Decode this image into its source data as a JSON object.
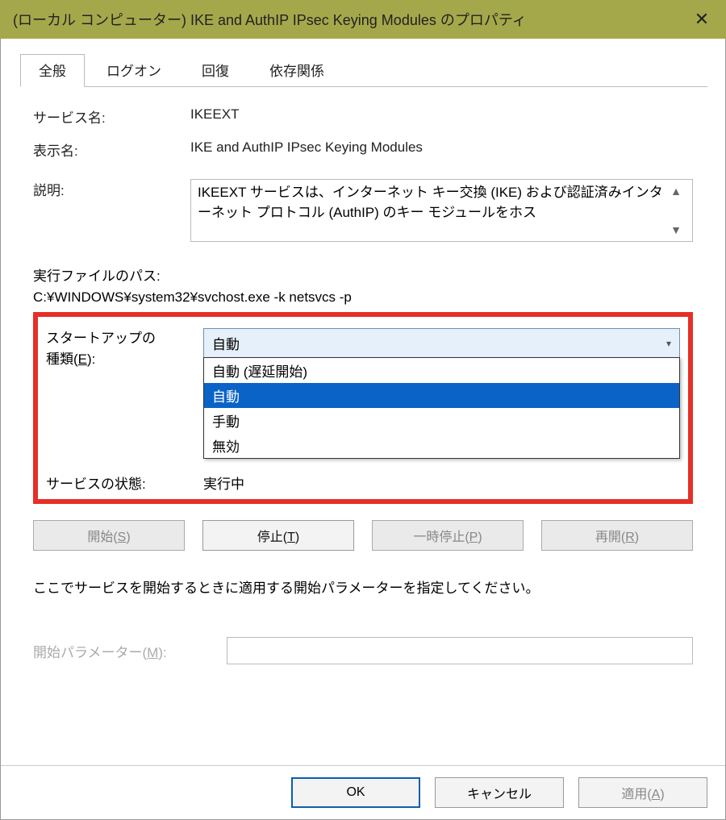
{
  "window": {
    "title": "(ローカル コンピューター) IKE and AuthIP IPsec Keying Modules のプロパティ"
  },
  "tabs": {
    "general": "全般",
    "logon": "ログオン",
    "recovery": "回復",
    "dependencies": "依存関係"
  },
  "fields": {
    "serviceNameLabel": "サービス名:",
    "serviceNameValue": "IKEEXT",
    "displayNameLabel": "表示名:",
    "displayNameValue": "IKE and AuthIP IPsec Keying Modules",
    "descriptionLabel": "説明:",
    "descriptionValue": "IKEEXT サービスは、インターネット キー交換 (IKE) および認証済みインターネット プロトコル (AuthIP) のキー モジュールをホス",
    "pathLabel": "実行ファイルのパス:",
    "pathValue": "C:¥WINDOWS¥system32¥svchost.exe -k netsvcs -p",
    "startupLabel1": "スタートアップの",
    "startupLabel2_pre": "種類(",
    "startupLabel2_u": "E",
    "startupLabel2_post": "):",
    "startupSelected": "自動",
    "startupOptions": [
      "自動 (遅延開始)",
      "自動",
      "手動",
      "無効"
    ],
    "statusLabel": "サービスの状態:",
    "statusValue": "実行中",
    "hint": "ここでサービスを開始するときに適用する開始パラメーターを指定してください。",
    "paramLabel_pre": "開始パラメーター(",
    "paramLabel_u": "M",
    "paramLabel_post": "):"
  },
  "buttons": {
    "start_pre": "開始(",
    "start_u": "S",
    "start_post": ")",
    "stop_pre": "停止(",
    "stop_u": "T",
    "stop_post": ")",
    "pause_pre": "一時停止(",
    "pause_u": "P",
    "pause_post": ")",
    "resume_pre": "再開(",
    "resume_u": "R",
    "resume_post": ")",
    "ok": "OK",
    "cancel": "キャンセル",
    "apply_pre": "適用(",
    "apply_u": "A",
    "apply_post": ")"
  }
}
